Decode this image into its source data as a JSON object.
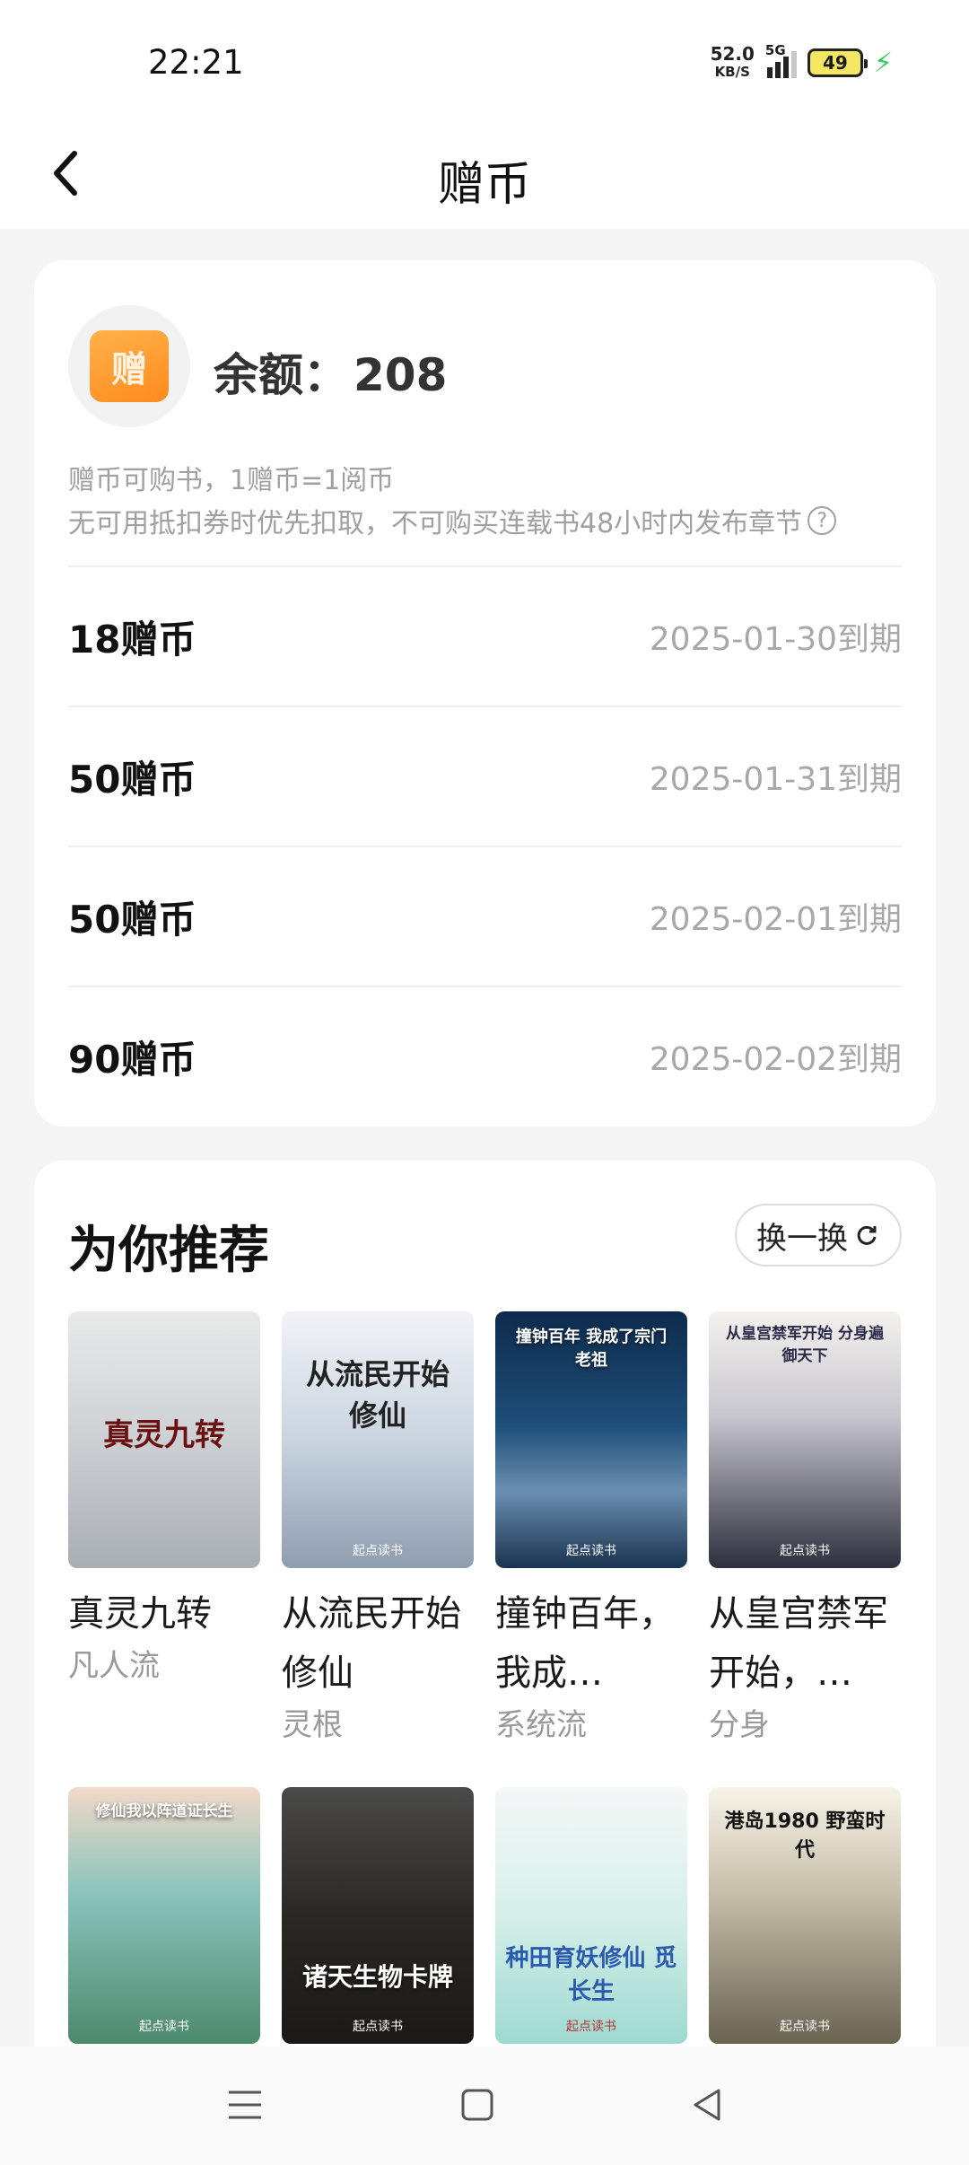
{
  "status_bar": {
    "time": "22:21",
    "net_speed": "52.0",
    "net_unit": "KB/S",
    "network": "5G",
    "battery": "49"
  },
  "header": {
    "title": "赠币"
  },
  "balance": {
    "label": "余额：",
    "value": "208",
    "badge_char": "赠",
    "desc_line1": "赠币可购书，1赠币=1阅币",
    "desc_line2": "无可用抵扣券时优先扣取，不可购买连载书48小时内发布章节",
    "items": [
      {
        "amount": "18赠币",
        "expire": "2025-01-30到期"
      },
      {
        "amount": "50赠币",
        "expire": "2025-01-31到期"
      },
      {
        "amount": "50赠币",
        "expire": "2025-02-01到期"
      },
      {
        "amount": "90赠币",
        "expire": "2025-02-02到期"
      }
    ]
  },
  "recommend": {
    "title": "为你推荐",
    "refresh_label": "换一换",
    "books": [
      {
        "name": "真灵九转",
        "tag": "凡人流",
        "cover_text": "真灵九转"
      },
      {
        "name": "从流民开始修仙",
        "tag": "灵根",
        "cover_text": "从流民开始修仙"
      },
      {
        "name": "撞钟百年，我成…",
        "tag": "系统流",
        "cover_text": "撞钟百年 我成了宗门老祖"
      },
      {
        "name": "从皇宫禁军开始，…",
        "tag": "分身",
        "cover_text": "从皇宫禁军开始 分身遍御天下"
      },
      {
        "name": "",
        "tag": "",
        "cover_text": "修仙我以阵道证长生"
      },
      {
        "name": "",
        "tag": "",
        "cover_text": "诸天生物卡牌"
      },
      {
        "name": "",
        "tag": "",
        "cover_text": "种田育妖修仙 觅长生"
      },
      {
        "name": "",
        "tag": "",
        "cover_text": "港岛1980 野蛮时代"
      }
    ],
    "cover_brand": "起点读书"
  }
}
